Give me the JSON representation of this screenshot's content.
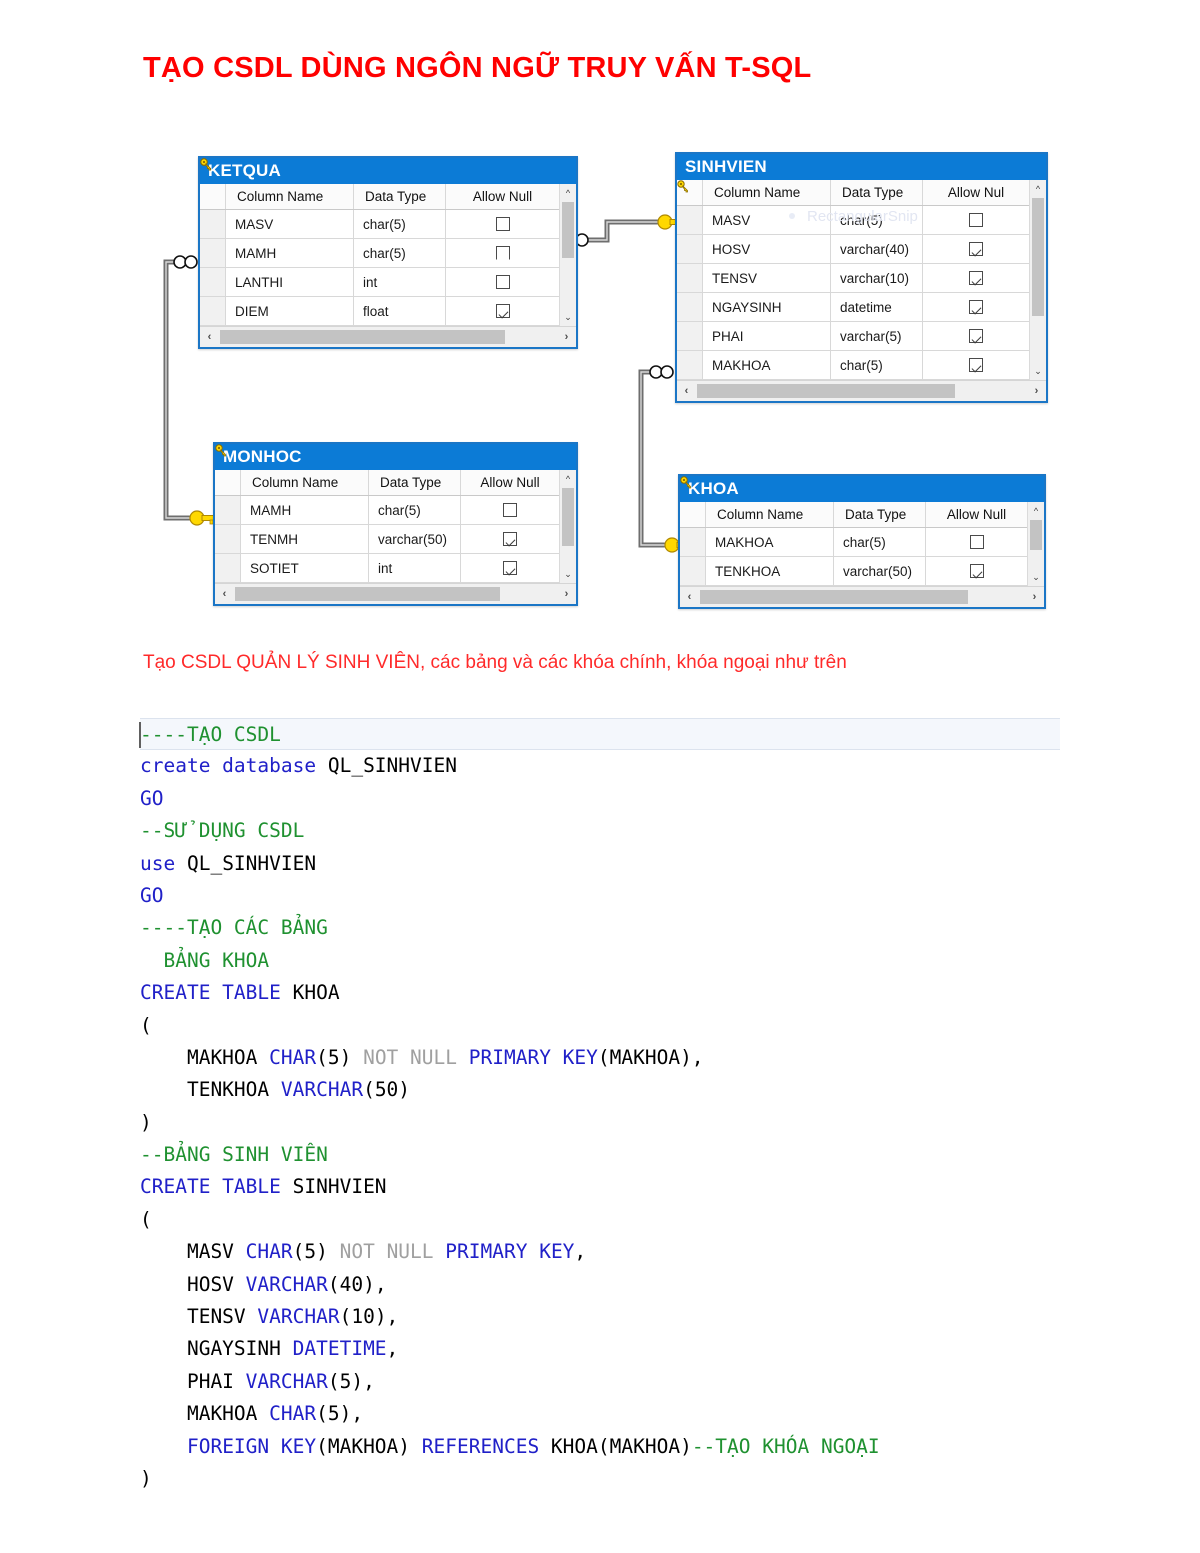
{
  "title": "TẠO CSDL DÙNG NGÔN NGỮ TRUY VẤN T-SQL",
  "caption": "Tạo CSDL QUẢN LÝ SINH VIÊN, các bảng và các khóa chính, khóa ngoại như trên",
  "colors": {
    "title_red": "#FF0000",
    "caption_red": "#FF2A2A",
    "table_header_blue": "#0C7BD6",
    "table_border_blue": "#1B76C6",
    "keyword_blue": "#2020C8",
    "comment_green": "#1F9130",
    "dim_grey": "#A0A0A0",
    "key_icon_yellow": "#FFD800"
  },
  "diagram": {
    "watermark": "RectangularSnip",
    "grid_headers": {
      "col_name": "Column Name",
      "data_type": "Data Type",
      "allow_null": "Allow Null"
    },
    "tables": [
      {
        "name": "KETQUA",
        "allow_null_header": "Allow Null",
        "rows": [
          {
            "key": true,
            "name": "MASV",
            "type": "char(5)",
            "allow_null": "unchecked"
          },
          {
            "key": true,
            "name": "MAMH",
            "type": "char(5)",
            "allow_null": "partial"
          },
          {
            "key": true,
            "name": "LANTHI",
            "type": "int",
            "allow_null": "unchecked"
          },
          {
            "key": false,
            "name": "DIEM",
            "type": "float",
            "allow_null": "checked"
          }
        ]
      },
      {
        "name": "SINHVIEN",
        "allow_null_header": "Allow Nul",
        "rows": [
          {
            "key": true,
            "name": "MASV",
            "type": "char(5)",
            "allow_null": "unchecked"
          },
          {
            "key": false,
            "name": "HOSV",
            "type": "varchar(40)",
            "allow_null": "checked"
          },
          {
            "key": false,
            "name": "TENSV",
            "type": "varchar(10)",
            "allow_null": "checked"
          },
          {
            "key": false,
            "name": "NGAYSINH",
            "type": "datetime",
            "allow_null": "checked"
          },
          {
            "key": false,
            "name": "PHAI",
            "type": "varchar(5)",
            "allow_null": "checked"
          },
          {
            "key": false,
            "name": "MAKHOA",
            "type": "char(5)",
            "allow_null": "checked"
          }
        ]
      },
      {
        "name": "MONHOC",
        "allow_null_header": "Allow Null",
        "rows": [
          {
            "key": true,
            "name": "MAMH",
            "type": "char(5)",
            "allow_null": "unchecked"
          },
          {
            "key": false,
            "name": "TENMH",
            "type": "varchar(50)",
            "allow_null": "checked"
          },
          {
            "key": false,
            "name": "SOTIET",
            "type": "int",
            "allow_null": "checked"
          }
        ]
      },
      {
        "name": "KHOA",
        "allow_null_header": "Allow Null",
        "rows": [
          {
            "key": true,
            "name": "MAKHOA",
            "type": "char(5)",
            "allow_null": "unchecked"
          },
          {
            "key": false,
            "name": "TENKHOA",
            "type": "varchar(50)",
            "allow_null": "checked"
          }
        ]
      }
    ],
    "relationships": [
      {
        "from": "SINHVIEN",
        "to": "KETQUA",
        "one_side": "SINHVIEN",
        "many_side": "KETQUA"
      },
      {
        "from": "MONHOC",
        "to": "KETQUA",
        "one_side": "MONHOC",
        "many_side": "KETQUA"
      },
      {
        "from": "KHOA",
        "to": "SINHVIEN",
        "one_side": "KHOA",
        "many_side": "SINHVIEN"
      }
    ]
  },
  "code": {
    "lines": [
      {
        "active": true,
        "caret": true,
        "tokens": [
          {
            "t": "----TẠO CSDL",
            "c": "cmt"
          }
        ]
      },
      {
        "tokens": [
          {
            "t": "create database ",
            "c": "kw"
          },
          {
            "t": "QL_SINHVIEN",
            "c": "id"
          }
        ]
      },
      {
        "tokens": [
          {
            "t": "GO",
            "c": "kw"
          }
        ]
      },
      {
        "tokens": [
          {
            "t": "--SỬ DỤNG CSDL",
            "c": "cmt"
          }
        ]
      },
      {
        "tokens": [
          {
            "t": "use ",
            "c": "kw"
          },
          {
            "t": "QL_SINHVIEN",
            "c": "id"
          }
        ]
      },
      {
        "tokens": [
          {
            "t": "GO",
            "c": "kw"
          }
        ]
      },
      {
        "tokens": [
          {
            "t": "----TẠO CÁC BẢNG",
            "c": "cmt"
          }
        ]
      },
      {
        "tokens": [
          {
            "t": "  BẢNG KHOA",
            "c": "cmt"
          }
        ]
      },
      {
        "tokens": [
          {
            "t": "CREATE TABLE ",
            "c": "kw"
          },
          {
            "t": "KHOA",
            "c": "id"
          }
        ]
      },
      {
        "tokens": [
          {
            "t": "(",
            "c": "id"
          }
        ]
      },
      {
        "tokens": [
          {
            "t": "    MAKHOA ",
            "c": "id"
          },
          {
            "t": "CHAR",
            "c": "kw"
          },
          {
            "t": "(5) ",
            "c": "id"
          },
          {
            "t": "NOT NULL ",
            "c": "dim"
          },
          {
            "t": "PRIMARY KEY",
            "c": "kw"
          },
          {
            "t": "(MAKHOA),",
            "c": "id"
          }
        ]
      },
      {
        "tokens": [
          {
            "t": "    TENKHOA ",
            "c": "id"
          },
          {
            "t": "VARCHAR",
            "c": "kw"
          },
          {
            "t": "(50)",
            "c": "id"
          }
        ]
      },
      {
        "tokens": [
          {
            "t": ")",
            "c": "id"
          }
        ]
      },
      {
        "tokens": [
          {
            "t": "--BẢNG SINH VIÊN",
            "c": "cmt"
          }
        ]
      },
      {
        "tokens": [
          {
            "t": "CREATE TABLE ",
            "c": "kw"
          },
          {
            "t": "SINHVIEN",
            "c": "id"
          }
        ]
      },
      {
        "tokens": [
          {
            "t": "(",
            "c": "id"
          }
        ]
      },
      {
        "tokens": [
          {
            "t": "    MASV ",
            "c": "id"
          },
          {
            "t": "CHAR",
            "c": "kw"
          },
          {
            "t": "(5) ",
            "c": "id"
          },
          {
            "t": "NOT NULL ",
            "c": "dim"
          },
          {
            "t": "PRIMARY KEY",
            "c": "kw"
          },
          {
            "t": ",",
            "c": "id"
          }
        ]
      },
      {
        "tokens": [
          {
            "t": "    HOSV ",
            "c": "id"
          },
          {
            "t": "VARCHAR",
            "c": "kw"
          },
          {
            "t": "(40),",
            "c": "id"
          }
        ]
      },
      {
        "tokens": [
          {
            "t": "    TENSV ",
            "c": "id"
          },
          {
            "t": "VARCHAR",
            "c": "kw"
          },
          {
            "t": "(10),",
            "c": "id"
          }
        ]
      },
      {
        "tokens": [
          {
            "t": "    NGAYSINH ",
            "c": "id"
          },
          {
            "t": "DATETIME",
            "c": "kw"
          },
          {
            "t": ",",
            "c": "id"
          }
        ]
      },
      {
        "tokens": [
          {
            "t": "    PHAI ",
            "c": "id"
          },
          {
            "t": "VARCHAR",
            "c": "kw"
          },
          {
            "t": "(5),",
            "c": "id"
          }
        ]
      },
      {
        "tokens": [
          {
            "t": "    MAKHOA ",
            "c": "id"
          },
          {
            "t": "CHAR",
            "c": "kw"
          },
          {
            "t": "(5),",
            "c": "id"
          }
        ]
      },
      {
        "tokens": [
          {
            "t": "    ",
            "c": "id"
          },
          {
            "t": "FOREIGN KEY",
            "c": "kw"
          },
          {
            "t": "(MAKHOA) ",
            "c": "id"
          },
          {
            "t": "REFERENCES",
            "c": "kw"
          },
          {
            "t": " KHOA(MAKHOA)",
            "c": "id"
          },
          {
            "t": "--TẠO KHÓA NGOẠI",
            "c": "cmt"
          }
        ]
      },
      {
        "tokens": [
          {
            "t": ")",
            "c": "id"
          }
        ]
      }
    ]
  }
}
